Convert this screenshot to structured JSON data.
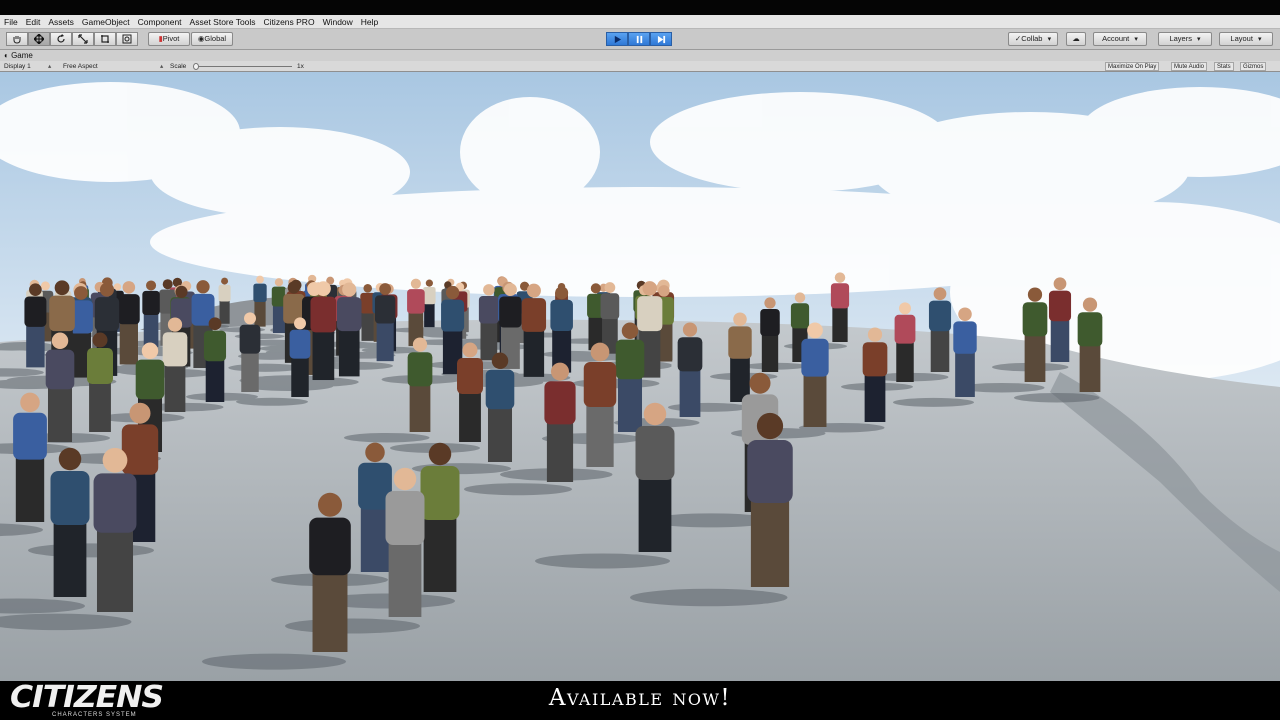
{
  "menubar": {
    "items": [
      "File",
      "Edit",
      "Assets",
      "GameObject",
      "Component",
      "Asset Store Tools",
      "Citizens PRO",
      "Window",
      "Help"
    ]
  },
  "toolbar": {
    "tools": [
      {
        "name": "hand-tool",
        "icon": "hand-icon"
      },
      {
        "name": "move-tool",
        "icon": "move-arrows-icon",
        "active": true
      },
      {
        "name": "rotate-tool",
        "icon": "rotate-icon"
      },
      {
        "name": "scale-tool",
        "icon": "scale-icon"
      },
      {
        "name": "rect-tool",
        "icon": "rect-icon"
      },
      {
        "name": "transform-tool",
        "icon": "transform-icon"
      }
    ],
    "pivot_label": "Pivot",
    "global_label": "Global",
    "play_state": "playing",
    "collab_label": "Collab",
    "account_label": "Account",
    "layers_label": "Layers",
    "layout_label": "Layout",
    "accent_color": "#3a86e8"
  },
  "game_view": {
    "tab_label": "Game",
    "display_label": "Display 1",
    "aspect_label": "Free Aspect",
    "scale_label": "Scale",
    "scale_value": "1x",
    "maximize_label": "Maximize On Play",
    "mute_label": "Mute Audio",
    "stats_label": "Stats",
    "gizmos_label": "Gizmos"
  },
  "footer": {
    "logo_text": "CITIZENS",
    "logo_subtitle": "CHARACTERS SYSTEM",
    "tagline": "Available now!"
  }
}
